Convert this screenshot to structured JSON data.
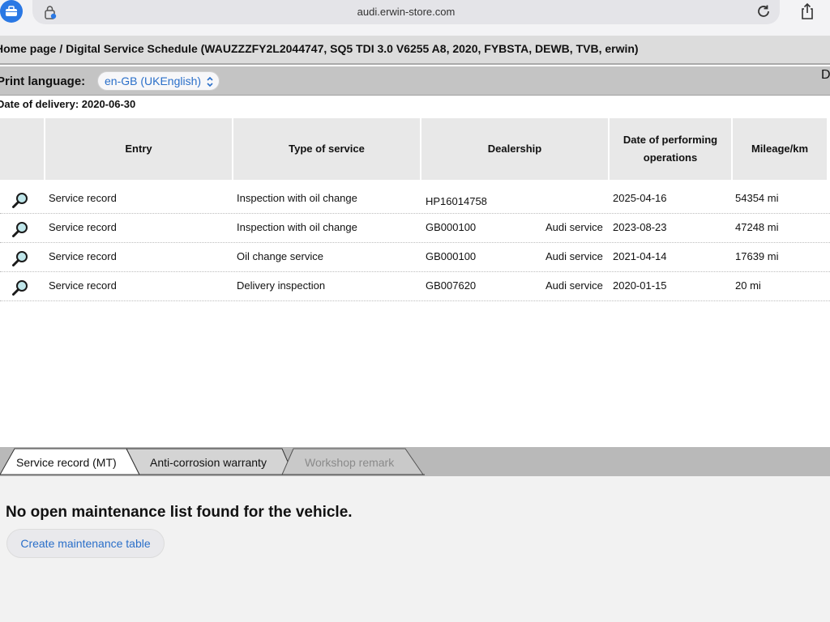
{
  "browser": {
    "url": "audi.erwin-store.com"
  },
  "breadcrumb": "Home page / Digital Service Schedule (WAUZZZFY2L2044747, SQ5 TDI 3.0 V6255 A8, 2020, FYBSTA, DEWB, TVB, erwin)",
  "print_language": {
    "label": "Print language:",
    "selected": "en-GB (UKEnglish)",
    "overflow_char": "D"
  },
  "delivery": "Date of delivery: 2020-06-30",
  "table": {
    "headers": {
      "entry": "Entry",
      "type": "Type of service",
      "dealership": "Dealership",
      "date": "Date of performing operations",
      "mileage": "Mileage/km"
    },
    "rows": [
      {
        "entry": "Service record",
        "type": "Inspection with oil change",
        "dealer_code": "HP16014758",
        "dealer_name": "",
        "date": "2025-04-16",
        "mileage": "54354 mi"
      },
      {
        "entry": "Service record",
        "type": "Inspection with oil change",
        "dealer_code": "GB000100",
        "dealer_name": "Audi service",
        "date": "2023-08-23",
        "mileage": "47248 mi"
      },
      {
        "entry": "Service record",
        "type": "Oil change service",
        "dealer_code": "GB000100",
        "dealer_name": "Audi service",
        "date": "2021-04-14",
        "mileage": "17639 mi"
      },
      {
        "entry": "Service record",
        "type": "Delivery inspection",
        "dealer_code": "GB007620",
        "dealer_name": "Audi service",
        "date": "2020-01-15",
        "mileage": "20 mi"
      }
    ]
  },
  "tabs": {
    "service_record": "Service record (MT)",
    "anti_corrosion": "Anti-corrosion warranty",
    "workshop_remark": "Workshop remark"
  },
  "maintenance": {
    "message": "No open maintenance list found for the vehicle.",
    "create_button": "Create maintenance table"
  },
  "colors": {
    "link": "#2a6fc9",
    "accent": "#2a78e4"
  }
}
